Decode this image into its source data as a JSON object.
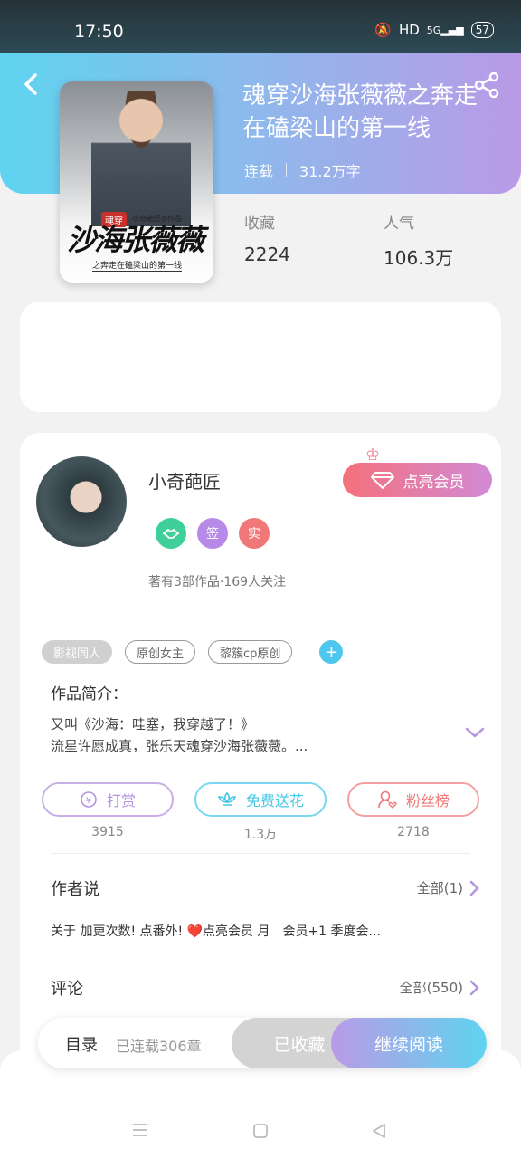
{
  "status_bar": {
    "time": "17:50",
    "network": "HD",
    "signal": "5G",
    "battery": "57"
  },
  "book": {
    "title": "魂穿沙海张薇薇之奔走在磕梁山的第一线",
    "status": "连载",
    "word_count": "31.2万字",
    "favorites_label": "收藏",
    "favorites_value": "2224",
    "popularity_label": "人气",
    "popularity_value": "106.3万",
    "cover": {
      "tag": "魂穿",
      "author_line": "小奇葩匠◎作品",
      "calligraphy": "沙海张薇薇",
      "subtitle": "之奔走在磕梁山的第一线"
    }
  },
  "author": {
    "name": "小奇葩匠",
    "badge_sign": "签",
    "badge_real": "实",
    "vip_button": "点亮会员",
    "works_info": "著有3部作品·169人关注"
  },
  "tags": [
    "影视同人",
    "原创女主",
    "黎簇cp原创"
  ],
  "intro": {
    "title": "作品简介：",
    "line1": "又叫《沙海：哇塞，我穿越了！》",
    "line2": "流星许愿成真，张乐天魂穿沙海张薇薇。..."
  },
  "actions": [
    {
      "label": "打赏",
      "count": "3915",
      "color": "#b494e0"
    },
    {
      "label": "免费送花",
      "count": "1.3万",
      "color": "#45c8e8"
    },
    {
      "label": "粉丝榜",
      "count": "2718",
      "color": "#f07878"
    }
  ],
  "author_says": {
    "title": "作者说",
    "more": "全部(1)",
    "content": "关于 加更次数! 点番外! ❤️点亮会员 月　会员+1 季度会..."
  },
  "comments": {
    "title": "评论",
    "more": "全部(550)"
  },
  "bottom_bar": {
    "toc": "目录",
    "chapters": "已连载306章",
    "favorited": "已收藏",
    "continue": "继续阅读"
  }
}
